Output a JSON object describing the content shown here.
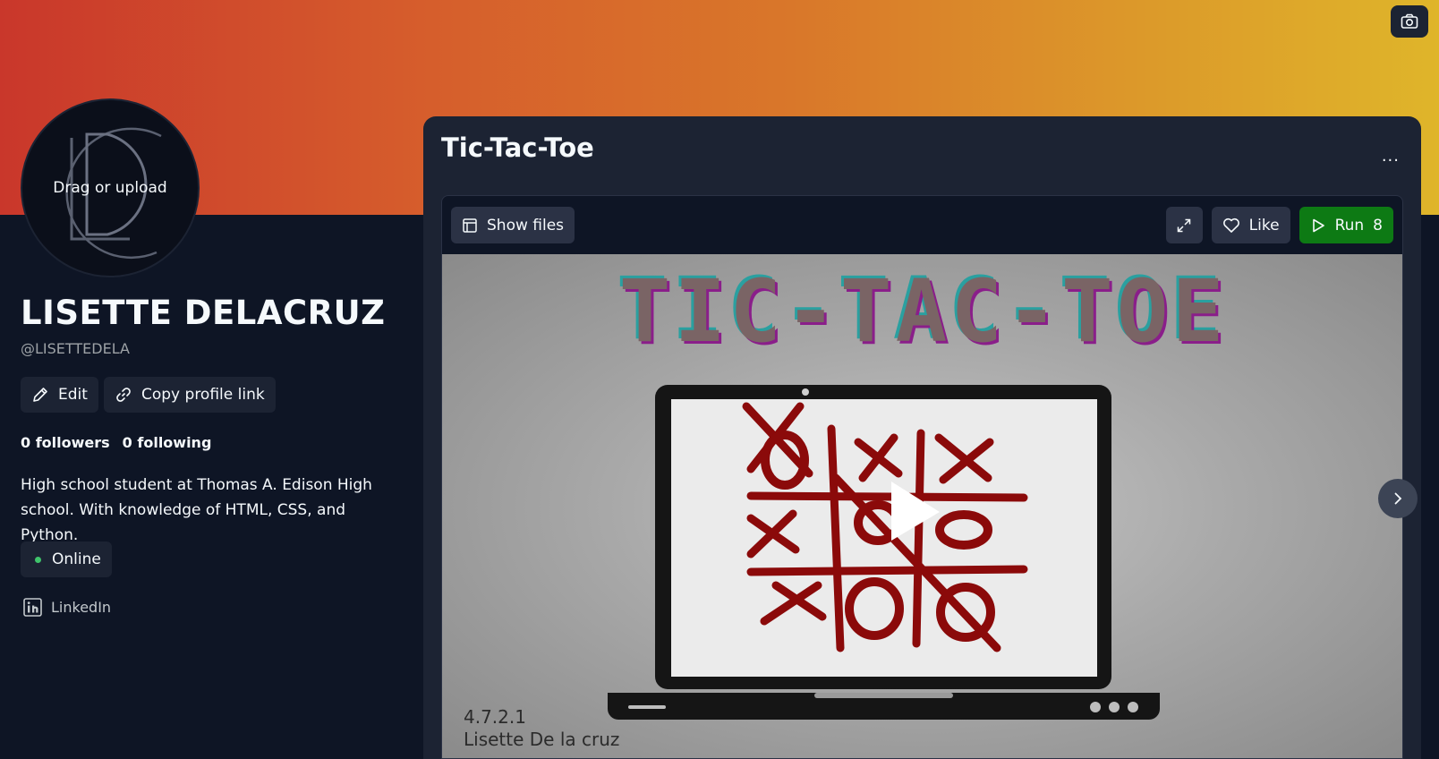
{
  "banner": {
    "colors": [
      "#c9372b",
      "#dfb52a"
    ],
    "camera_icon": "camera-icon"
  },
  "profile": {
    "avatar_label": "Drag or upload",
    "name": "LISETTE DELACRUZ",
    "handle": "@LISETTEDELA",
    "edit_label": "Edit",
    "copy_label": "Copy profile link",
    "followers": "0 followers",
    "following": "0 following",
    "bio": "High school student at Thomas A. Edison High school. With knowledge of HTML, CSS, and Python.",
    "status": "Online",
    "status_color": "#3fc46b",
    "linkedin": "LinkedIn"
  },
  "card": {
    "title": "Tic-Tac-Toe",
    "more": "...",
    "show_files": "Show files",
    "like": "Like",
    "run": "Run",
    "run_count": "8",
    "run_color": "#0d7a14",
    "preview_banner": "TIC-TAC-TOE",
    "caption_version": "4.7.2.1",
    "caption_author": "Lisette De la cruz"
  }
}
